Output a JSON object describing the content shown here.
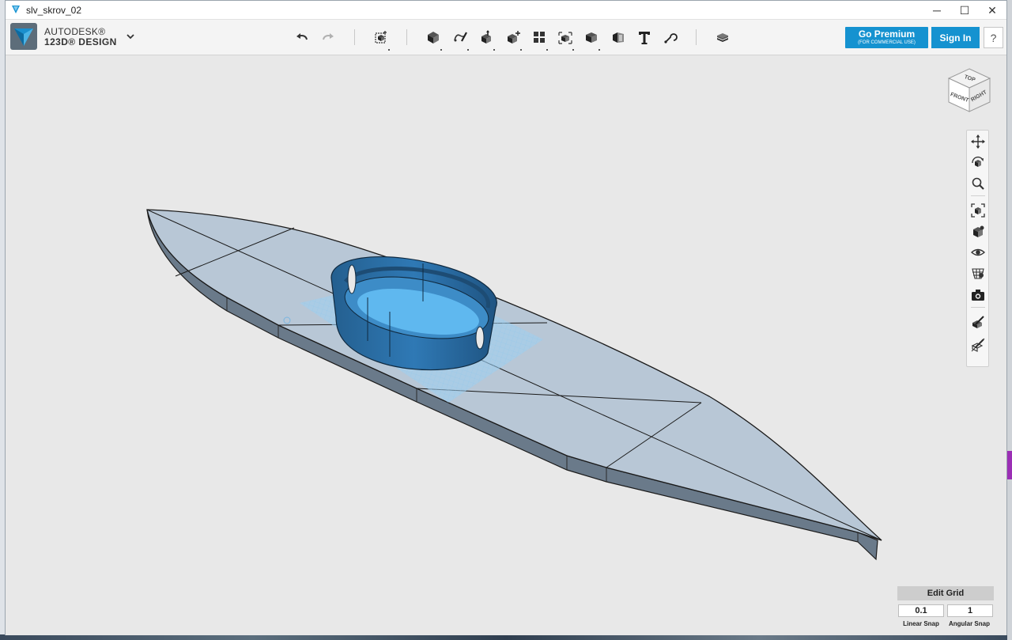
{
  "window": {
    "title": "slv_skrov_02",
    "controls": {
      "minimize": "─",
      "maximize": "☐",
      "close": "✕"
    }
  },
  "brand": {
    "line1": "AUTODESK®",
    "line2": "123D® DESIGN",
    "icon": "autodesk-123d-logo"
  },
  "toolbar": {
    "tools": [
      {
        "name": "undo",
        "icon": "undo-icon"
      },
      {
        "name": "redo",
        "icon": "redo-icon"
      },
      {
        "name": "transform",
        "icon": "transform-icon"
      },
      {
        "name": "primitives",
        "icon": "primitives-icon"
      },
      {
        "name": "sketch",
        "icon": "sketch-icon"
      },
      {
        "name": "construct",
        "icon": "construct-icon"
      },
      {
        "name": "modify",
        "icon": "modify-icon"
      },
      {
        "name": "pattern",
        "icon": "pattern-icon"
      },
      {
        "name": "grouping",
        "icon": "grouping-icon"
      },
      {
        "name": "combine",
        "icon": "combine-icon"
      },
      {
        "name": "measure",
        "icon": "measure-icon"
      },
      {
        "name": "text",
        "icon": "text-icon"
      },
      {
        "name": "snap",
        "icon": "snap-icon"
      },
      {
        "name": "material",
        "icon": "material-icon"
      }
    ],
    "premium_label": "Go Premium",
    "premium_sub": "(FOR COMMERCIAL USE)",
    "signin_label": "Sign In",
    "help_label": "?"
  },
  "viewcube": {
    "top": "TOP",
    "front": "FRONT",
    "right": "RIGHT"
  },
  "navbar": {
    "items": [
      "pan-icon",
      "orbit-icon",
      "zoom-icon",
      "fit-icon",
      "views-icon",
      "visibility-icon",
      "material-display-icon",
      "camera-icon",
      "edit-tool-icon",
      "hide-tool-icon"
    ]
  },
  "grid": {
    "edit_label": "Edit Grid",
    "linear_value": "0.1",
    "angular_value": "1",
    "linear_label": "Linear Snap",
    "angular_label": "Angular Snap"
  },
  "colors": {
    "accent": "#1592d0",
    "hull_top": "#b7c6d6",
    "hull_side": "#6c7b8c",
    "cockpit": "#2f79b5",
    "cockpit_inner": "#5eb8ef",
    "viewport_bg": "#e8e8e8"
  }
}
